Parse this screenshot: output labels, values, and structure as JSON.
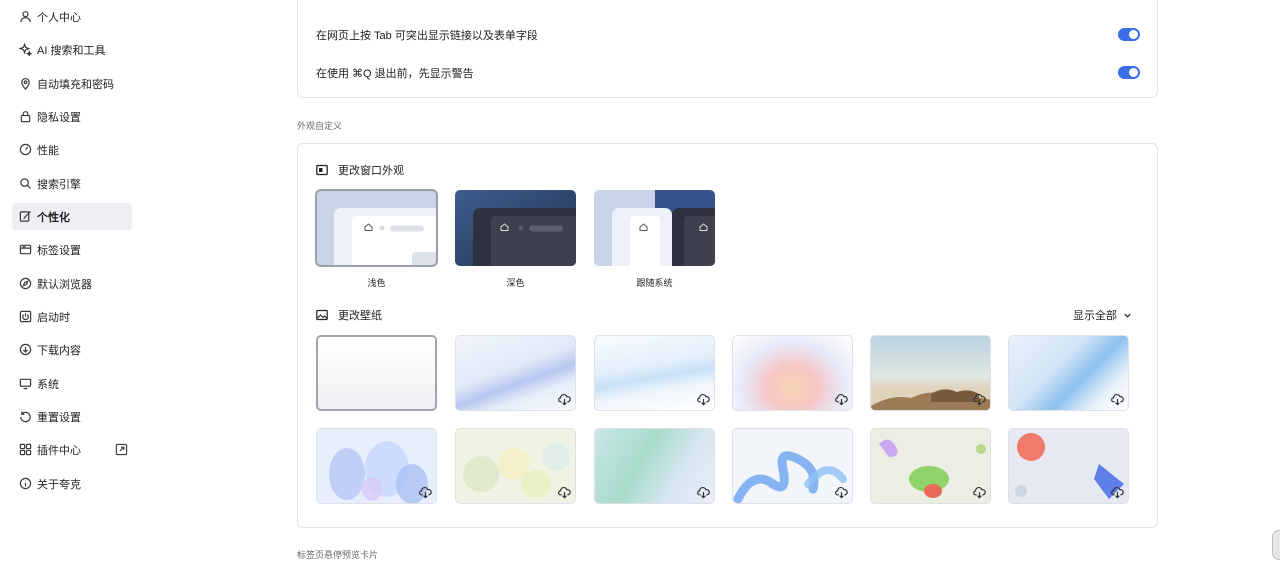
{
  "sidebar": {
    "items": [
      {
        "label": "个人中心",
        "icon": "user-icon"
      },
      {
        "label": "AI 搜索和工具",
        "icon": "sparkle-icon"
      },
      {
        "label": "自动填充和密码",
        "icon": "location-pin-icon"
      },
      {
        "label": "隐私设置",
        "icon": "lock-icon"
      },
      {
        "label": "性能",
        "icon": "speedometer-icon"
      },
      {
        "label": "搜索引擎",
        "icon": "search-icon"
      },
      {
        "label": "个性化",
        "icon": "brush-icon",
        "active": true
      },
      {
        "label": "标签设置",
        "icon": "tab-icon"
      },
      {
        "label": "默认浏览器",
        "icon": "compass-icon"
      },
      {
        "label": "启动时",
        "icon": "power-icon"
      },
      {
        "label": "下载内容",
        "icon": "download-icon"
      },
      {
        "label": "系统",
        "icon": "monitor-icon"
      },
      {
        "label": "重置设置",
        "icon": "reset-icon"
      },
      {
        "label": "插件中心",
        "icon": "grid-icon"
      },
      {
        "label": "关于夸克",
        "icon": "info-icon"
      }
    ]
  },
  "top_card": {
    "rows": [
      {
        "label": "在网页上按 Tab 可突出显示链接以及表单字段",
        "enabled": true
      },
      {
        "label": "在使用 ⌘Q 退出前，先显示警告",
        "enabled": true
      }
    ]
  },
  "appearance": {
    "section_label": "外观自定义",
    "window_heading": "更改窗口外观",
    "themes": [
      {
        "label": "浅色",
        "selected": true
      },
      {
        "label": "深色",
        "selected": false
      },
      {
        "label": "跟随系统",
        "selected": false
      }
    ],
    "wallpaper_heading": "更改壁纸",
    "show_all": "显示全部",
    "wallpapers": [
      "plain-white",
      "blue-wave",
      "light-blue-wave",
      "pastel-gradient",
      "desert-landscape",
      "blue-glass-curve",
      "blue-petals",
      "yellow-green-circles",
      "mint-gradient",
      "blue-ribbons",
      "green-organic-shapes",
      "red-blue-abstract"
    ]
  },
  "next_section_label": "标签页悬停预览卡片",
  "colors": {
    "accent": "#3b6ee8",
    "active_bg": "#eeeff2",
    "card_border": "#e3e4e8"
  }
}
